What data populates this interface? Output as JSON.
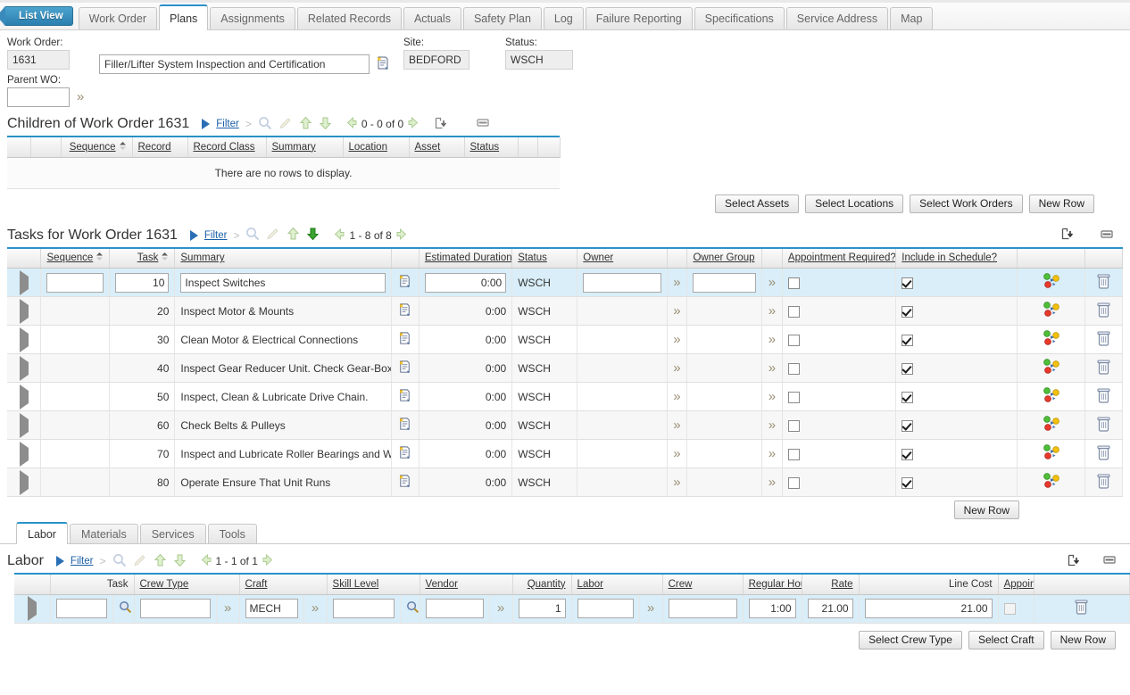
{
  "topTabs": {
    "listView": "List View",
    "items": [
      {
        "label": "Work Order",
        "active": false
      },
      {
        "label": "Plans",
        "active": true
      },
      {
        "label": "Assignments",
        "active": false
      },
      {
        "label": "Related Records",
        "active": false
      },
      {
        "label": "Actuals",
        "active": false
      },
      {
        "label": "Safety Plan",
        "active": false
      },
      {
        "label": "Log",
        "active": false
      },
      {
        "label": "Failure Reporting",
        "active": false
      },
      {
        "label": "Specifications",
        "active": false
      },
      {
        "label": "Service Address",
        "active": false
      },
      {
        "label": "Map",
        "active": false
      }
    ]
  },
  "header": {
    "workOrderLabel": "Work Order:",
    "workOrderValue": "1631",
    "descriptionValue": "Filler/Lifter System Inspection and Certification",
    "siteLabel": "Site:",
    "siteValue": "BEDFORD",
    "statusLabel": "Status:",
    "statusValue": "WSCH",
    "parentWoLabel": "Parent WO:",
    "parentWoValue": ""
  },
  "children": {
    "title": "Children of Work Order 1631",
    "filterLabel": "Filter",
    "pager": "0 - 0 of 0",
    "columns": [
      "Sequence",
      "Record",
      "Record Class",
      "Summary",
      "Location",
      "Asset",
      "Status"
    ],
    "emptyText": "There are no rows to display.",
    "buttons": [
      "Select Assets",
      "Select Locations",
      "Select Work Orders",
      "New Row"
    ]
  },
  "tasks": {
    "title": "Tasks for Work Order 1631",
    "filterLabel": "Filter",
    "pager": "1 - 8 of 8",
    "columns": {
      "sequence": "Sequence",
      "task": "Task",
      "summary": "Summary",
      "estimatedDuration": "Estimated Duration",
      "status": "Status",
      "owner": "Owner",
      "ownerGroup": "Owner Group",
      "appointmentRequired": "Appointment Required?",
      "includeInSchedule": "Include in Schedule?"
    },
    "rows": [
      {
        "sequence": "",
        "task": "10",
        "summary": "Inspect Switches",
        "duration": "0:00",
        "status": "WSCH",
        "owner": "",
        "ownerGroup": "",
        "appointment": false,
        "include": true,
        "selected": true
      },
      {
        "sequence": "",
        "task": "20",
        "summary": "Inspect Motor & Mounts",
        "duration": "0:00",
        "status": "WSCH",
        "owner": "",
        "ownerGroup": "",
        "appointment": false,
        "include": true,
        "selected": false
      },
      {
        "sequence": "",
        "task": "30",
        "summary": "Clean Motor & Electrical Connections",
        "duration": "0:00",
        "status": "WSCH",
        "owner": "",
        "ownerGroup": "",
        "appointment": false,
        "include": true,
        "selected": false
      },
      {
        "sequence": "",
        "task": "40",
        "summary": "Inspect Gear Reducer Unit. Check Gear-Box",
        "duration": "0:00",
        "status": "WSCH",
        "owner": "",
        "ownerGroup": "",
        "appointment": false,
        "include": true,
        "selected": false
      },
      {
        "sequence": "",
        "task": "50",
        "summary": "Inspect, Clean & Lubricate Drive Chain.",
        "duration": "0:00",
        "status": "WSCH",
        "owner": "",
        "ownerGroup": "",
        "appointment": false,
        "include": true,
        "selected": false
      },
      {
        "sequence": "",
        "task": "60",
        "summary": "Check Belts & Pulleys",
        "duration": "0:00",
        "status": "WSCH",
        "owner": "",
        "ownerGroup": "",
        "appointment": false,
        "include": true,
        "selected": false
      },
      {
        "sequence": "",
        "task": "70",
        "summary": "Inspect and Lubricate Roller Bearings and W",
        "duration": "0:00",
        "status": "WSCH",
        "owner": "",
        "ownerGroup": "",
        "appointment": false,
        "include": true,
        "selected": false
      },
      {
        "sequence": "",
        "task": "80",
        "summary": "Operate Ensure That Unit Runs",
        "duration": "0:00",
        "status": "WSCH",
        "owner": "",
        "ownerGroup": "",
        "appointment": false,
        "include": true,
        "selected": false
      }
    ],
    "newRowLabel": "New Row"
  },
  "subTabs": [
    {
      "label": "Labor",
      "active": true
    },
    {
      "label": "Materials",
      "active": false
    },
    {
      "label": "Services",
      "active": false
    },
    {
      "label": "Tools",
      "active": false
    }
  ],
  "labor": {
    "title": "Labor",
    "filterLabel": "Filter",
    "pager": "1 - 1 of 1",
    "columns": {
      "task": "Task",
      "crewType": "Crew Type",
      "craft": "Craft",
      "skillLevel": "Skill Level",
      "vendor": "Vendor",
      "quantity": "Quantity",
      "labor": "Labor",
      "crew": "Crew",
      "regularHours": "Regular Hours",
      "rate": "Rate",
      "lineCost": "Line Cost",
      "appointmentRequired": "Appointment Required?"
    },
    "rows": [
      {
        "task": "",
        "crewType": "",
        "craft": "MECH",
        "skillLevel": "",
        "vendor": "",
        "quantity": "1",
        "labor": "",
        "crew": "",
        "regularHours": "1:00",
        "rate": "21.00",
        "lineCost": "21.00",
        "appointment": false,
        "selected": true
      }
    ],
    "buttons": [
      "Select Crew Type",
      "Select Craft",
      "New Row"
    ]
  },
  "colors": {
    "accent": "#2a91c9",
    "selectedRow": "#d9eef8",
    "link": "#1a5fa8",
    "listViewTab": "#2a7fb0"
  }
}
